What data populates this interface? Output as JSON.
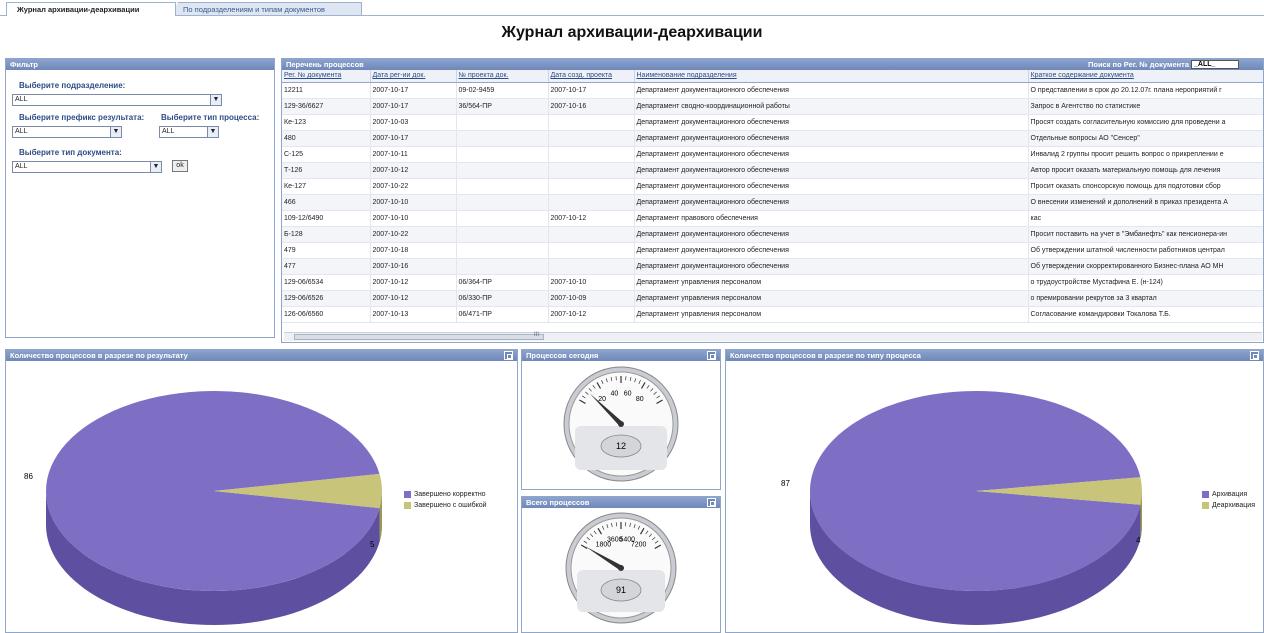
{
  "tabs": [
    {
      "label": "Журнал архивации-деархивации"
    },
    {
      "label": "По подразделениям и типам документов"
    }
  ],
  "page_title": "Журнал архивации-деархивации",
  "filter": {
    "title": "Фильтр",
    "division_label": "Выберите подразделение:",
    "division_value": "ALL",
    "prefix_label": "Выберите префикс результата:",
    "process_type_label": "Выберите тип процесса:",
    "prefix_value": "ALL",
    "process_type_value": "ALL",
    "doctype_label": "Выберите тип документа:",
    "doctype_value": "ALL",
    "ok_label": "ok"
  },
  "process_list": {
    "title": "Перечень процессов",
    "search_label": "Поиск по Рег. № документа",
    "search_value": "_ALL_",
    "columns": [
      "Рег. № документа",
      "Дата рег-ии док.",
      "№ проекта док.",
      "Дата созд. проекта",
      "Наименование подразделения",
      "Краткое содержание документа"
    ],
    "rows": [
      [
        "12211",
        "2007-10-17",
        "09-02-9459",
        "2007-10-17",
        "Департамент документационного обеспечения",
        "О представлении в срок до 20.12.07г. плана нероприятий г"
      ],
      [
        "129-36/6627",
        "2007-10-17",
        "36/564-ПР",
        "2007-10-16",
        "Департамент сводно-координационной работы",
        "Запрос в Агентство по статистике"
      ],
      [
        "Ке-123",
        "2007-10-03",
        "",
        "",
        "Департамент документационного обеспечения",
        "Просят создать согласительную комиссию для проведени а"
      ],
      [
        "480",
        "2007-10-17",
        "",
        "",
        "Департамент документационного обеспечения",
        "Отдельные вопросы АО \"Сенсер\""
      ],
      [
        "С-125",
        "2007-10-11",
        "",
        "",
        "Департамент документационного обеспечения",
        "Инвалид 2 группы просит решить вопрос о прикреплении е"
      ],
      [
        "Т-126",
        "2007-10-12",
        "",
        "",
        "Департамент документационного обеспечения",
        "Автор просит оказать материальную помощь для лечения"
      ],
      [
        "Ке-127",
        "2007-10-22",
        "",
        "",
        "Департамент документационного обеспечения",
        "Просит оказать спонсорскую помощь для подготовки сбор"
      ],
      [
        "466",
        "2007-10-10",
        "",
        "",
        "Департамент документационного обеспечения",
        "О внесении изменений и дополнений в приказ президента А"
      ],
      [
        "109-12/6490",
        "2007-10-10",
        "",
        "2007-10-12",
        "Департамент правового обеспечения",
        "кас"
      ],
      [
        "Б-128",
        "2007-10-22",
        "",
        "",
        "Департамент документационного обеспечения",
        "Просит поставить на учет в \"Эмбанефть\" как пенсионера-ин"
      ],
      [
        "479",
        "2007-10-18",
        "",
        "",
        "Департамент документационного обеспечения",
        "Об утверждении штатной численности работников централ"
      ],
      [
        "477",
        "2007-10-16",
        "",
        "",
        "Департамент документационного обеспечения",
        "Об утверждении скорректированного Бизнес-плана АО МН"
      ],
      [
        "129-06/6534",
        "2007-10-12",
        "06/364-ПР",
        "2007-10-10",
        "Департамент управления персоналом",
        "о трудоустройстве Мустафина Е. (н-124)"
      ],
      [
        "129-06/6526",
        "2007-10-12",
        "06/330-ПР",
        "2007-10-09",
        "Департамент управления персоналом",
        "о премировании рекрутов за 3 квартал"
      ],
      [
        "126-06/6560",
        "2007-10-13",
        "06/471-ПР",
        "2007-10-12",
        "Департамент управления персоналом",
        "Согласование командировки Токалова Т.Б."
      ]
    ],
    "scroll_marker": "III"
  },
  "chart_data": [
    {
      "type": "pie",
      "title": "Количество процессов в разрезе по результату",
      "categories": [
        "Завершено корректно",
        "Завершено с ошибкой"
      ],
      "values": [
        86,
        5
      ],
      "colors": [
        "#7f6fc4",
        "#c8c47a"
      ],
      "legend": "right"
    },
    {
      "type": "gauge",
      "title": "Процессов сегодня",
      "value": 12,
      "ticks": [
        "20",
        "40",
        "60",
        "80"
      ],
      "min": 0,
      "max": 100
    },
    {
      "type": "gauge",
      "title": "Всего процессов",
      "value": 91,
      "ticks": [
        "1800",
        "3600",
        "5400",
        "7200"
      ],
      "min": 0,
      "max": 9000
    },
    {
      "type": "pie",
      "title": "Количество процессов в разрезе по типу процесса",
      "categories": [
        "Архивация",
        "Деархивация"
      ],
      "values": [
        87,
        4
      ],
      "colors": [
        "#7f6fc4",
        "#c8c47a"
      ],
      "legend": "right"
    }
  ]
}
